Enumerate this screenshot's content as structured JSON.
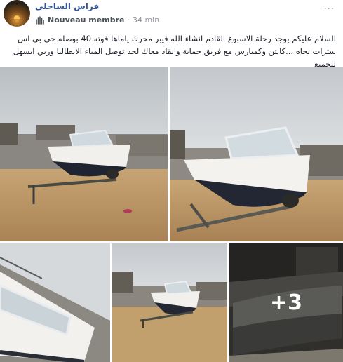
{
  "post": {
    "author_name": "فراس الساحلي",
    "role": "Nouveau membre",
    "separator": "·",
    "time": "34 min",
    "more_label": "···",
    "text": "السلام عليكم يوجد رحلة الاسبوع القادم انشاء الله فيبر محرك ياماها قوته 40 بوصله جي بي اس سترات نجاه ...كابتن وكمبارس مع فريق حماية وانقاذ معاك لحد توصل المياء الايطاليا وربي ايسهل للجميع"
  },
  "photos": {
    "more_count": "+3"
  },
  "colors": {
    "link": "#365899",
    "meta": "#90949c",
    "text": "#1d2129"
  },
  "icons": {
    "badge": "new-member-hand-icon",
    "more": "more-options-icon"
  }
}
